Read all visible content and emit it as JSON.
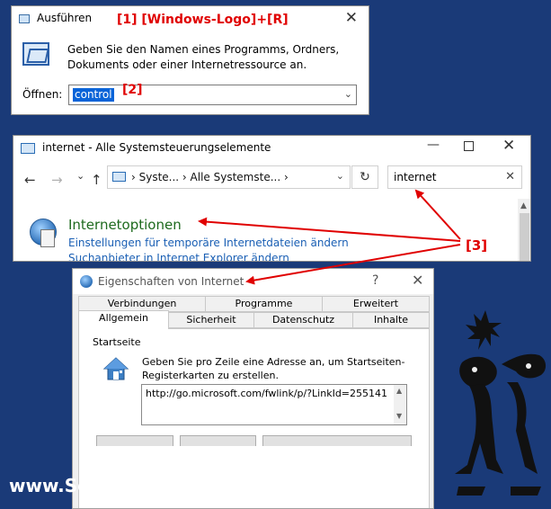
{
  "run_dialog": {
    "title": "Ausführen",
    "close_glyph": "✕",
    "description": "Geben Sie den Namen eines Programms, Ordners, Dokuments oder einer Internetressource an.",
    "open_label": "Öffnen:",
    "input_value": "control",
    "dropdown_glyph": "⌄",
    "icon": "run-icon"
  },
  "annotations": {
    "step1": "[1]  [Windows-Logo]+[R]",
    "step2": "[2]",
    "step3": "[3]",
    "color": "#e00000"
  },
  "control_panel": {
    "title": "internet - Alle Systemsteuerungselemente",
    "minimize_glyph": "—",
    "close_glyph": "✕",
    "nav": {
      "back": "←",
      "forward": "→",
      "dropdown": "⌄",
      "up": "↑"
    },
    "address": "›  Syste...  ›  Alle Systemste...  ›",
    "address_dropdown": "⌄",
    "refresh_glyph": "↻",
    "search_value": "internet",
    "search_clear_glyph": "✕",
    "result": {
      "title": "Internetoptionen",
      "link1": "Einstellungen für temporäre Internetdateien ändern",
      "link2": "Suchanbieter in Internet Explorer ändern"
    },
    "scroll_up_glyph": "▲"
  },
  "internet_properties": {
    "title": "Eigenschaften von Internet",
    "help_glyph": "?",
    "close_glyph": "✕",
    "tabs_row1": [
      "Verbindungen",
      "Programme",
      "Erweitert"
    ],
    "tabs_row2": [
      "Allgemein",
      "Sicherheit",
      "Datenschutz",
      "Inhalte"
    ],
    "active_tab": "Allgemein",
    "group_label": "Startseite",
    "hint": "Geben Sie pro Zeile eine Adresse an, um Startseiten-Registerkarten zu erstellen.",
    "homepage_url": "http://go.microsoft.com/fwlink/p/?LinkId=255141",
    "scroll_up_glyph": "▲",
    "scroll_down_glyph": "▼"
  },
  "footer": {
    "text": "www.SoftwareOK.de :-)"
  }
}
